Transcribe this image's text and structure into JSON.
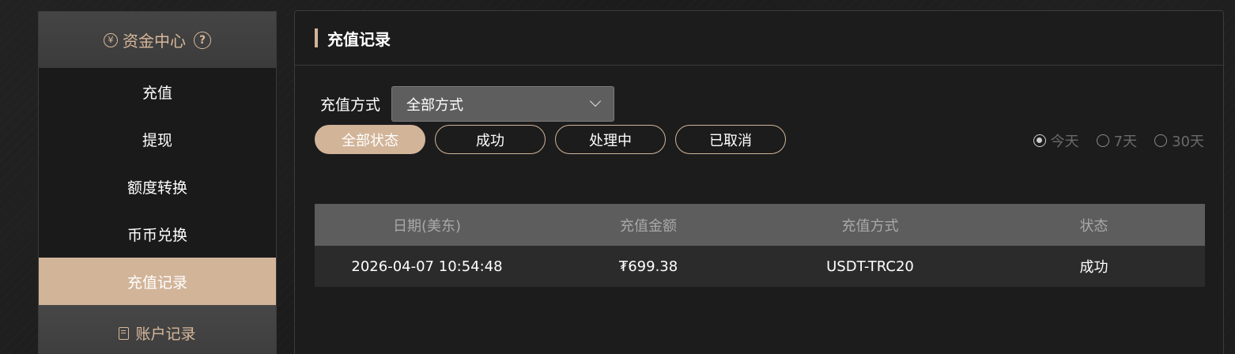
{
  "sidebar": {
    "header": "资金中心",
    "help_glyph": "?",
    "yen_glyph": "¥",
    "items": [
      {
        "label": "充值"
      },
      {
        "label": "提现"
      },
      {
        "label": "额度转换"
      },
      {
        "label": "币币兑换"
      },
      {
        "label": "充值记录"
      }
    ],
    "footer": "账户记录"
  },
  "panel": {
    "title": "充值记录",
    "filter_label": "充值方式",
    "method_select": "全部方式",
    "status_tabs": [
      {
        "label": "全部状态"
      },
      {
        "label": "成功"
      },
      {
        "label": "处理中"
      },
      {
        "label": "已取消"
      }
    ],
    "ranges": [
      {
        "label": "今天"
      },
      {
        "label": "7天"
      },
      {
        "label": "30天"
      }
    ]
  },
  "table": {
    "columns": [
      "日期(美东)",
      "充值金额",
      "充值方式",
      "状态"
    ],
    "rows": [
      {
        "date": "2026-04-07 10:54:48",
        "amount": "₮699.38",
        "method": "USDT-TRC20",
        "status": "成功"
      }
    ]
  },
  "colors": {
    "accent": "#d2b499",
    "accent_text": "#d8b89a",
    "background": "#1c1c1c",
    "table_header": "#5d5d5d",
    "table_row": "#2b2b2b"
  },
  "icons": {
    "sidebar_header": "yen-coin-icon",
    "help": "question-circle-icon",
    "footer": "record-book-icon",
    "select": "chevron-down-icon"
  }
}
